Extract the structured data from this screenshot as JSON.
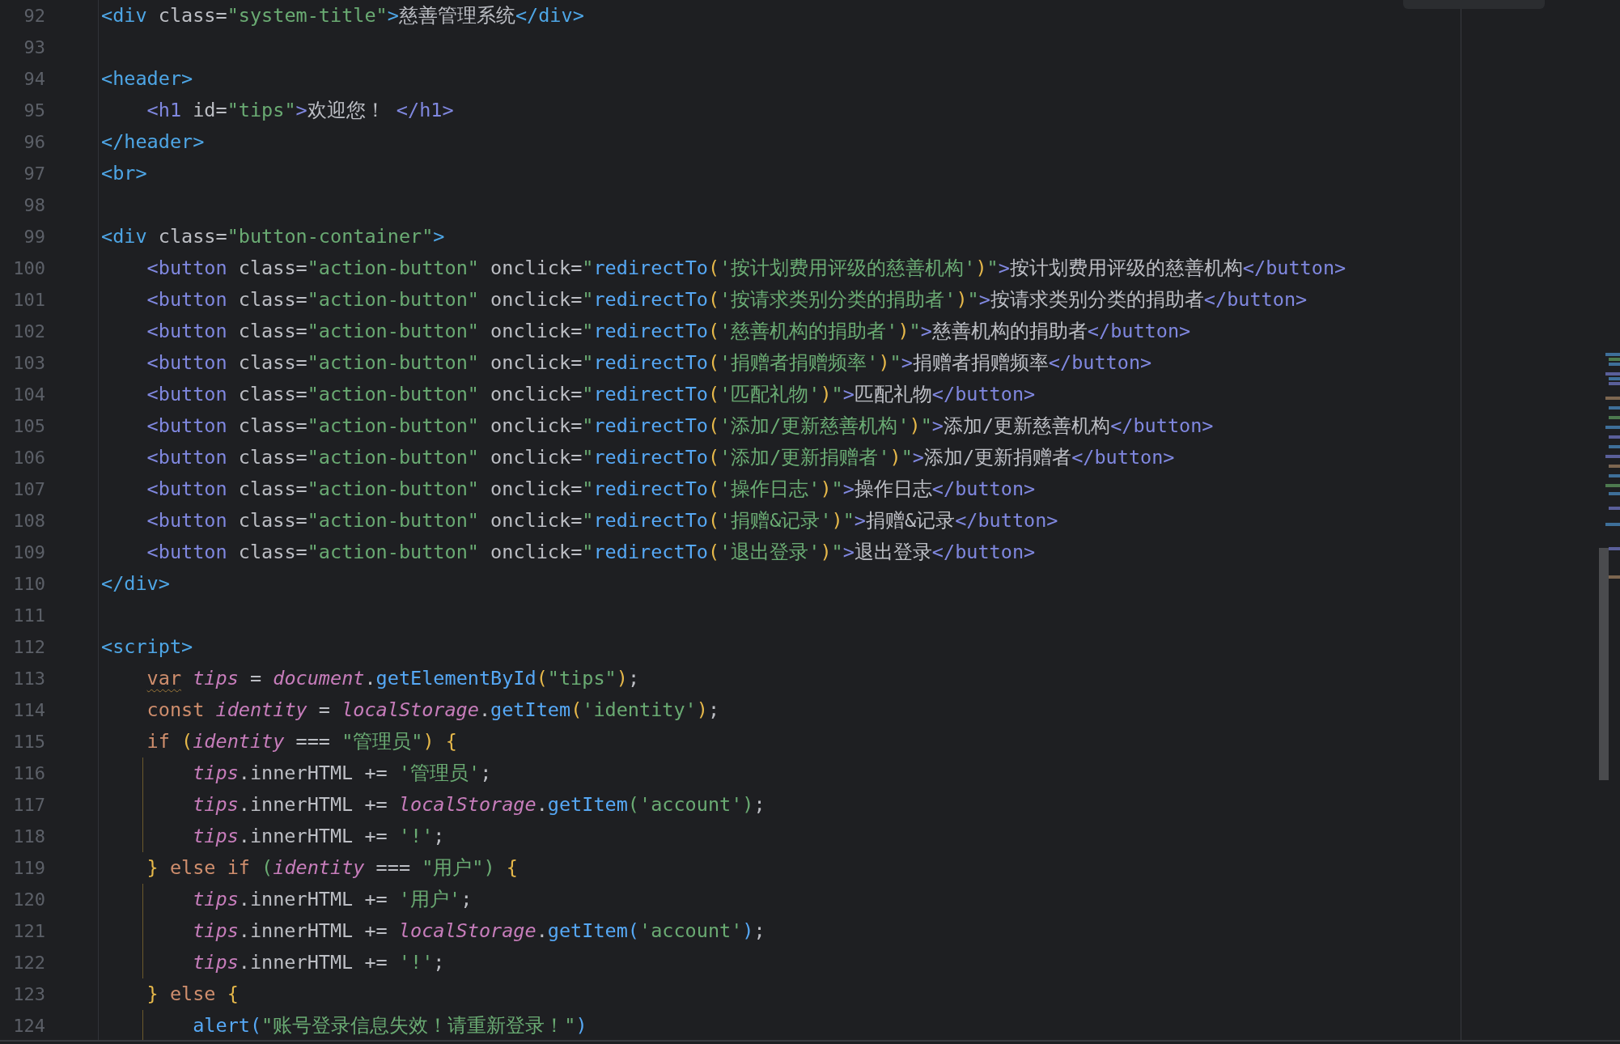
{
  "editor": {
    "lines": [
      {
        "number": "92",
        "guide": false,
        "tokens": [
          {
            "kind": "tag",
            "text": "<div"
          },
          {
            "kind": "attr",
            "text": " class"
          },
          {
            "kind": "plain",
            "text": "="
          },
          {
            "kind": "str",
            "text": "\"system-title\""
          },
          {
            "kind": "tag",
            "text": ">"
          },
          {
            "kind": "text",
            "text": "慈善管理系统"
          },
          {
            "kind": "tag",
            "text": "</div>"
          }
        ]
      },
      {
        "number": "93",
        "guide": false
      },
      {
        "number": "94",
        "guide": false,
        "tokens": [
          {
            "kind": "tag",
            "text": "<header>"
          }
        ]
      },
      {
        "number": "95",
        "guide": false,
        "tokens": [
          {
            "kind": "tag2",
            "text": "    <h1"
          },
          {
            "kind": "attr",
            "text": " id"
          },
          {
            "kind": "plain",
            "text": "="
          },
          {
            "kind": "str",
            "text": "\"tips\""
          },
          {
            "kind": "tag2",
            "text": ">"
          },
          {
            "kind": "text",
            "text": "欢迎您！"
          },
          {
            "kind": "tag2",
            "text": " </h1>"
          }
        ]
      },
      {
        "number": "96",
        "guide": false,
        "tokens": [
          {
            "kind": "tag",
            "text": "</header>"
          }
        ]
      },
      {
        "number": "97",
        "guide": false,
        "tokens": [
          {
            "kind": "tag",
            "text": "<br>"
          }
        ]
      },
      {
        "number": "98",
        "guide": false
      },
      {
        "number": "99",
        "guide": false,
        "tokens": [
          {
            "kind": "tag",
            "text": "<div"
          },
          {
            "kind": "attr",
            "text": " class"
          },
          {
            "kind": "plain",
            "text": "="
          },
          {
            "kind": "str",
            "text": "\"button-container\""
          },
          {
            "kind": "tag",
            "text": ">"
          }
        ]
      },
      {
        "number": "100",
        "guide": false,
        "tokens": [
          {
            "kind": "tag2",
            "text": "    <button"
          },
          {
            "kind": "attr",
            "text": " class"
          },
          {
            "kind": "plain",
            "text": "="
          },
          {
            "kind": "str",
            "text": "\"action-button\""
          },
          {
            "kind": "attr",
            "text": " onclick"
          },
          {
            "kind": "plain",
            "text": "="
          },
          {
            "kind": "str",
            "text": "\""
          },
          {
            "kind": "fn",
            "text": "redirectTo"
          },
          {
            "kind": "b1",
            "text": "("
          },
          {
            "kind": "str",
            "text": "'按计划费用评级的慈善机构'"
          },
          {
            "kind": "b1",
            "text": ")"
          },
          {
            "kind": "str",
            "text": "\""
          },
          {
            "kind": "tag2",
            "text": ">"
          },
          {
            "kind": "text",
            "text": "按计划费用评级的慈善机构"
          },
          {
            "kind": "tag2",
            "text": "</button>"
          }
        ]
      },
      {
        "number": "101",
        "guide": false,
        "tokens": [
          {
            "kind": "tag2",
            "text": "    <button"
          },
          {
            "kind": "attr",
            "text": " class"
          },
          {
            "kind": "plain",
            "text": "="
          },
          {
            "kind": "str",
            "text": "\"action-button\""
          },
          {
            "kind": "attr",
            "text": " onclick"
          },
          {
            "kind": "plain",
            "text": "="
          },
          {
            "kind": "str",
            "text": "\""
          },
          {
            "kind": "fn",
            "text": "redirectTo"
          },
          {
            "kind": "b1",
            "text": "("
          },
          {
            "kind": "str",
            "text": "'按请求类别分类的捐助者'"
          },
          {
            "kind": "b1",
            "text": ")"
          },
          {
            "kind": "str",
            "text": "\""
          },
          {
            "kind": "tag2",
            "text": ">"
          },
          {
            "kind": "text",
            "text": "按请求类别分类的捐助者"
          },
          {
            "kind": "tag2",
            "text": "</button>"
          }
        ]
      },
      {
        "number": "102",
        "guide": false,
        "tokens": [
          {
            "kind": "tag2",
            "text": "    <button"
          },
          {
            "kind": "attr",
            "text": " class"
          },
          {
            "kind": "plain",
            "text": "="
          },
          {
            "kind": "str",
            "text": "\"action-button\""
          },
          {
            "kind": "attr",
            "text": " onclick"
          },
          {
            "kind": "plain",
            "text": "="
          },
          {
            "kind": "str",
            "text": "\""
          },
          {
            "kind": "fn",
            "text": "redirectTo"
          },
          {
            "kind": "b1",
            "text": "("
          },
          {
            "kind": "str",
            "text": "'慈善机构的捐助者'"
          },
          {
            "kind": "b1",
            "text": ")"
          },
          {
            "kind": "str",
            "text": "\""
          },
          {
            "kind": "tag2",
            "text": ">"
          },
          {
            "kind": "text",
            "text": "慈善机构的捐助者"
          },
          {
            "kind": "tag2",
            "text": "</button>"
          }
        ]
      },
      {
        "number": "103",
        "guide": false,
        "tokens": [
          {
            "kind": "tag2",
            "text": "    <button"
          },
          {
            "kind": "attr",
            "text": " class"
          },
          {
            "kind": "plain",
            "text": "="
          },
          {
            "kind": "str",
            "text": "\"action-button\""
          },
          {
            "kind": "attr",
            "text": " onclick"
          },
          {
            "kind": "plain",
            "text": "="
          },
          {
            "kind": "str",
            "text": "\""
          },
          {
            "kind": "fn",
            "text": "redirectTo"
          },
          {
            "kind": "b1",
            "text": "("
          },
          {
            "kind": "str",
            "text": "'捐赠者捐赠频率'"
          },
          {
            "kind": "b1",
            "text": ")"
          },
          {
            "kind": "str",
            "text": "\""
          },
          {
            "kind": "tag2",
            "text": ">"
          },
          {
            "kind": "text",
            "text": "捐赠者捐赠频率"
          },
          {
            "kind": "tag2",
            "text": "</button>"
          }
        ]
      },
      {
        "number": "104",
        "guide": false,
        "tokens": [
          {
            "kind": "tag2",
            "text": "    <button"
          },
          {
            "kind": "attr",
            "text": " class"
          },
          {
            "kind": "plain",
            "text": "="
          },
          {
            "kind": "str",
            "text": "\"action-button\""
          },
          {
            "kind": "attr",
            "text": " onclick"
          },
          {
            "kind": "plain",
            "text": "="
          },
          {
            "kind": "str",
            "text": "\""
          },
          {
            "kind": "fn",
            "text": "redirectTo"
          },
          {
            "kind": "b1",
            "text": "("
          },
          {
            "kind": "str",
            "text": "'匹配礼物'"
          },
          {
            "kind": "b1",
            "text": ")"
          },
          {
            "kind": "str",
            "text": "\""
          },
          {
            "kind": "tag2",
            "text": ">"
          },
          {
            "kind": "text",
            "text": "匹配礼物"
          },
          {
            "kind": "tag2",
            "text": "</button>"
          }
        ]
      },
      {
        "number": "105",
        "guide": false,
        "tokens": [
          {
            "kind": "tag2",
            "text": "    <button"
          },
          {
            "kind": "attr",
            "text": " class"
          },
          {
            "kind": "plain",
            "text": "="
          },
          {
            "kind": "str",
            "text": "\"action-button\""
          },
          {
            "kind": "attr",
            "text": " onclick"
          },
          {
            "kind": "plain",
            "text": "="
          },
          {
            "kind": "str",
            "text": "\""
          },
          {
            "kind": "fn",
            "text": "redirectTo"
          },
          {
            "kind": "b1",
            "text": "("
          },
          {
            "kind": "str",
            "text": "'添加/更新慈善机构'"
          },
          {
            "kind": "b1",
            "text": ")"
          },
          {
            "kind": "str",
            "text": "\""
          },
          {
            "kind": "tag2",
            "text": ">"
          },
          {
            "kind": "text",
            "text": "添加/更新慈善机构"
          },
          {
            "kind": "tag2",
            "text": "</button>"
          }
        ]
      },
      {
        "number": "106",
        "guide": false,
        "tokens": [
          {
            "kind": "tag2",
            "text": "    <button"
          },
          {
            "kind": "attr",
            "text": " class"
          },
          {
            "kind": "plain",
            "text": "="
          },
          {
            "kind": "str",
            "text": "\"action-button\""
          },
          {
            "kind": "attr",
            "text": " onclick"
          },
          {
            "kind": "plain",
            "text": "="
          },
          {
            "kind": "str",
            "text": "\""
          },
          {
            "kind": "fn",
            "text": "redirectTo"
          },
          {
            "kind": "b1",
            "text": "("
          },
          {
            "kind": "str",
            "text": "'添加/更新捐赠者'"
          },
          {
            "kind": "b1",
            "text": ")"
          },
          {
            "kind": "str",
            "text": "\""
          },
          {
            "kind": "tag2",
            "text": ">"
          },
          {
            "kind": "text",
            "text": "添加/更新捐赠者"
          },
          {
            "kind": "tag2",
            "text": "</button>"
          }
        ]
      },
      {
        "number": "107",
        "guide": false,
        "tokens": [
          {
            "kind": "tag2",
            "text": "    <button"
          },
          {
            "kind": "attr",
            "text": " class"
          },
          {
            "kind": "plain",
            "text": "="
          },
          {
            "kind": "str",
            "text": "\"action-button\""
          },
          {
            "kind": "attr",
            "text": " onclick"
          },
          {
            "kind": "plain",
            "text": "="
          },
          {
            "kind": "str",
            "text": "\""
          },
          {
            "kind": "fn",
            "text": "redirectTo"
          },
          {
            "kind": "b1",
            "text": "("
          },
          {
            "kind": "str",
            "text": "'操作日志'"
          },
          {
            "kind": "b1",
            "text": ")"
          },
          {
            "kind": "str",
            "text": "\""
          },
          {
            "kind": "tag2",
            "text": ">"
          },
          {
            "kind": "text",
            "text": "操作日志"
          },
          {
            "kind": "tag2",
            "text": "</button>"
          }
        ]
      },
      {
        "number": "108",
        "guide": false,
        "tokens": [
          {
            "kind": "tag2",
            "text": "    <button"
          },
          {
            "kind": "attr",
            "text": " class"
          },
          {
            "kind": "plain",
            "text": "="
          },
          {
            "kind": "str",
            "text": "\"action-button\""
          },
          {
            "kind": "attr",
            "text": " onclick"
          },
          {
            "kind": "plain",
            "text": "="
          },
          {
            "kind": "str",
            "text": "\""
          },
          {
            "kind": "fn",
            "text": "redirectTo"
          },
          {
            "kind": "b1",
            "text": "("
          },
          {
            "kind": "str",
            "text": "'捐赠&记录'"
          },
          {
            "kind": "b1",
            "text": ")"
          },
          {
            "kind": "str",
            "text": "\""
          },
          {
            "kind": "tag2",
            "text": ">"
          },
          {
            "kind": "text",
            "text": "捐赠&记录"
          },
          {
            "kind": "tag2",
            "text": "</button>"
          }
        ]
      },
      {
        "number": "109",
        "guide": false,
        "tokens": [
          {
            "kind": "tag2",
            "text": "    <button"
          },
          {
            "kind": "attr",
            "text": " class"
          },
          {
            "kind": "plain",
            "text": "="
          },
          {
            "kind": "str",
            "text": "\"action-button\""
          },
          {
            "kind": "attr",
            "text": " onclick"
          },
          {
            "kind": "plain",
            "text": "="
          },
          {
            "kind": "str",
            "text": "\""
          },
          {
            "kind": "fn",
            "text": "redirectTo"
          },
          {
            "kind": "b1",
            "text": "("
          },
          {
            "kind": "str",
            "text": "'退出登录'"
          },
          {
            "kind": "b1",
            "text": ")"
          },
          {
            "kind": "str",
            "text": "\""
          },
          {
            "kind": "tag2",
            "text": ">"
          },
          {
            "kind": "text",
            "text": "退出登录"
          },
          {
            "kind": "tag2",
            "text": "</button>"
          }
        ]
      },
      {
        "number": "110",
        "guide": false,
        "tokens": [
          {
            "kind": "tag",
            "text": "</div>"
          }
        ]
      },
      {
        "number": "111",
        "guide": false
      },
      {
        "number": "112",
        "guide": false,
        "tokens": [
          {
            "kind": "tag",
            "text": "<script>"
          }
        ]
      },
      {
        "number": "113",
        "guide": false,
        "tokens": [
          {
            "kind": "warn",
            "text": "    var"
          },
          {
            "kind": "var",
            "text": " tips"
          },
          {
            "kind": "plain",
            "text": " = "
          },
          {
            "kind": "var",
            "text": "document"
          },
          {
            "kind": "plain",
            "text": "."
          },
          {
            "kind": "fn",
            "text": "getElementById"
          },
          {
            "kind": "b1",
            "text": "("
          },
          {
            "kind": "str",
            "text": "\"tips\""
          },
          {
            "kind": "b1",
            "text": ")"
          },
          {
            "kind": "plain",
            "text": ";"
          }
        ]
      },
      {
        "number": "114",
        "guide": false,
        "tokens": [
          {
            "kind": "kw",
            "text": "    const"
          },
          {
            "kind": "var",
            "text": " identity"
          },
          {
            "kind": "plain",
            "text": " = "
          },
          {
            "kind": "var",
            "text": "localStorage"
          },
          {
            "kind": "plain",
            "text": "."
          },
          {
            "kind": "fn",
            "text": "getItem"
          },
          {
            "kind": "b1",
            "text": "("
          },
          {
            "kind": "str",
            "text": "'identity'"
          },
          {
            "kind": "b1",
            "text": ")"
          },
          {
            "kind": "plain",
            "text": ";"
          }
        ]
      },
      {
        "number": "115",
        "guide": false,
        "tokens": [
          {
            "kind": "kw",
            "text": "    if"
          },
          {
            "kind": "b1",
            "text": " ("
          },
          {
            "kind": "var",
            "text": "identity"
          },
          {
            "kind": "plain",
            "text": " === "
          },
          {
            "kind": "str",
            "text": "\"管理员\""
          },
          {
            "kind": "b1",
            "text": ")"
          },
          {
            "kind": "b1",
            "text": " {"
          }
        ]
      },
      {
        "number": "116",
        "guide": true,
        "tokens": [
          {
            "kind": "var",
            "text": "        tips"
          },
          {
            "kind": "plain",
            "text": ".innerHTML += "
          },
          {
            "kind": "str",
            "text": "'管理员'"
          },
          {
            "kind": "plain",
            "text": ";"
          }
        ]
      },
      {
        "number": "117",
        "guide": true,
        "tokens": [
          {
            "kind": "var",
            "text": "        tips"
          },
          {
            "kind": "plain",
            "text": ".innerHTML += "
          },
          {
            "kind": "var",
            "text": "localStorage"
          },
          {
            "kind": "plain",
            "text": "."
          },
          {
            "kind": "fn",
            "text": "getItem"
          },
          {
            "kind": "b2",
            "text": "("
          },
          {
            "kind": "str",
            "text": "'account'"
          },
          {
            "kind": "b2",
            "text": ")"
          },
          {
            "kind": "plain",
            "text": ";"
          }
        ]
      },
      {
        "number": "118",
        "guide": true,
        "tokens": [
          {
            "kind": "var",
            "text": "        tips"
          },
          {
            "kind": "plain",
            "text": ".innerHTML += "
          },
          {
            "kind": "str",
            "text": "'!'"
          },
          {
            "kind": "plain",
            "text": ";"
          }
        ]
      },
      {
        "number": "119",
        "guide": false,
        "tokens": [
          {
            "kind": "b1",
            "text": "    }"
          },
          {
            "kind": "kw",
            "text": " else if "
          },
          {
            "kind": "b2",
            "text": "("
          },
          {
            "kind": "var",
            "text": "identity"
          },
          {
            "kind": "plain",
            "text": " === "
          },
          {
            "kind": "str",
            "text": "\"用户\""
          },
          {
            "kind": "b2",
            "text": ")"
          },
          {
            "kind": "b1",
            "text": " {"
          }
        ]
      },
      {
        "number": "120",
        "guide": true,
        "tokens": [
          {
            "kind": "var",
            "text": "        tips"
          },
          {
            "kind": "plain",
            "text": ".innerHTML += "
          },
          {
            "kind": "str",
            "text": "'用户'"
          },
          {
            "kind": "plain",
            "text": ";"
          }
        ]
      },
      {
        "number": "121",
        "guide": true,
        "tokens": [
          {
            "kind": "var",
            "text": "        tips"
          },
          {
            "kind": "plain",
            "text": ".innerHTML += "
          },
          {
            "kind": "var",
            "text": "localStorage"
          },
          {
            "kind": "plain",
            "text": "."
          },
          {
            "kind": "fn",
            "text": "getItem"
          },
          {
            "kind": "b3",
            "text": "("
          },
          {
            "kind": "str",
            "text": "'account'"
          },
          {
            "kind": "b3",
            "text": ")"
          },
          {
            "kind": "plain",
            "text": ";"
          }
        ]
      },
      {
        "number": "122",
        "guide": true,
        "tokens": [
          {
            "kind": "var",
            "text": "        tips"
          },
          {
            "kind": "plain",
            "text": ".innerHTML += "
          },
          {
            "kind": "str",
            "text": "'!'"
          },
          {
            "kind": "plain",
            "text": ";"
          }
        ]
      },
      {
        "number": "123",
        "guide": false,
        "tokens": [
          {
            "kind": "b1",
            "text": "    }"
          },
          {
            "kind": "kw",
            "text": " else "
          },
          {
            "kind": "b1",
            "text": "{"
          }
        ]
      },
      {
        "number": "124",
        "guide": true,
        "tokens": [
          {
            "kind": "fn",
            "text": "        alert"
          },
          {
            "kind": "b3",
            "text": "("
          },
          {
            "kind": "str",
            "text": "\"账号登录信息失效！请重新登录！\""
          },
          {
            "kind": "b3",
            "text": ")"
          }
        ]
      }
    ]
  }
}
